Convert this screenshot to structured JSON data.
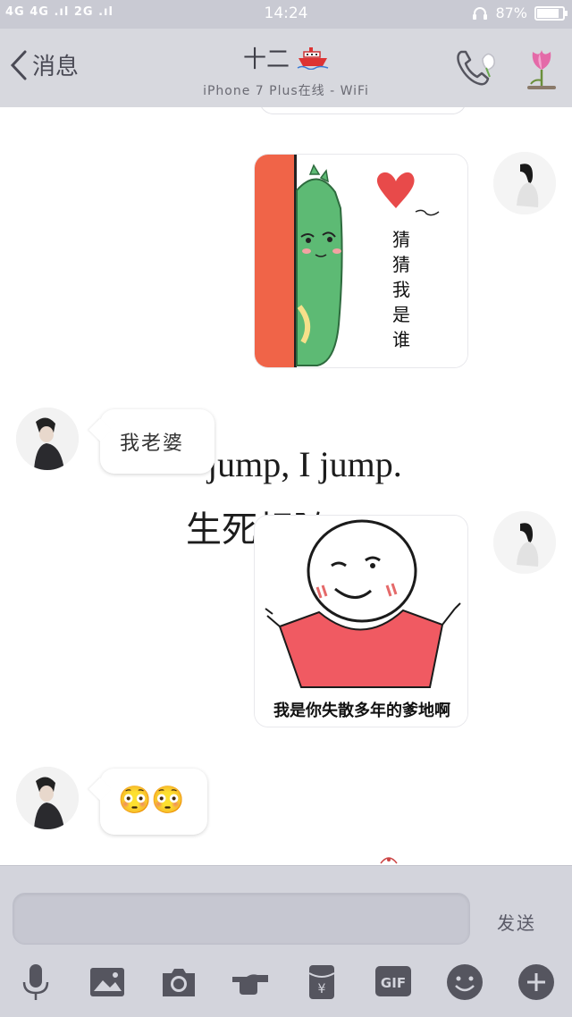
{
  "status_bar": {
    "signal_text": "4G 4G .ıl 2G .ıl",
    "time": "14:24",
    "battery_percent": "87%",
    "battery_level": 0.87
  },
  "header": {
    "back_label": "消息",
    "contact_name": "十二",
    "online_status": "iPhone 7 Plus在线 - WiFi"
  },
  "messages": [
    {
      "side": "right",
      "type": "sticker",
      "sticker_text": "猜猜我是谁"
    },
    {
      "side": "left",
      "type": "text",
      "text": "我老婆"
    },
    {
      "side": "right",
      "type": "sticker",
      "sticker_text": "我是你失散多年的爹地啊"
    },
    {
      "side": "left",
      "type": "text",
      "text": "😳😳"
    }
  ],
  "background_text": {
    "line1": "jump, I jump.",
    "line2": "生死相随"
  },
  "input": {
    "value": "",
    "send_label": "发送"
  },
  "toolbar": {
    "gif_label": "GIF",
    "items": [
      "mic-icon",
      "image-icon",
      "camera-icon",
      "poke-icon",
      "red-packet-icon",
      "gif-icon",
      "emoji-icon",
      "plus-icon"
    ]
  },
  "colors": {
    "header_bg": "#d7d8de",
    "sticker_red": "#f05a5a",
    "dragon_green": "#4db36f",
    "input_bg": "#d3d4dc"
  }
}
